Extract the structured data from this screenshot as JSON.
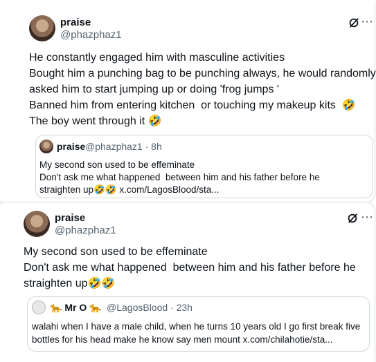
{
  "post1": {
    "name": "praise",
    "handle": "@phazphaz1",
    "lines": [
      "He constantly engaged him with masculine activities",
      "Bought him a punching bag to be punching always, he would randomly",
      "asked him to start jumping up or doing 'frog jumps '",
      "Banned him from entering kitchen  or touching my makeup kits  🤣",
      "The boy went through it 🤣"
    ],
    "quote": {
      "name": "praise",
      "meta": "@phazphaz1 · 8h",
      "lines": [
        "My second son used to be effeminate",
        "Don't ask me what happened  between him and his father before he",
        "straighten up🤣🤣 x.com/LagosBlood/sta..."
      ]
    }
  },
  "post2": {
    "name": "praise",
    "handle": "@phazphaz1",
    "lines": [
      "My second son used to be effeminate",
      "Don't ask me what happened  between him and his father before he",
      "straighten up🤣🤣"
    ],
    "quote": {
      "name": "🐆 Mr O 🐆",
      "meta": "@LagosBlood · 23h",
      "lines": [
        "walahi when I have a male child, when he turns 10 years old I go first break five",
        "bottles for his head make he know say men mount x.com/chilahotie/sta..."
      ]
    }
  },
  "icons": {
    "grok": "grok-icon",
    "more": "more-icon"
  }
}
